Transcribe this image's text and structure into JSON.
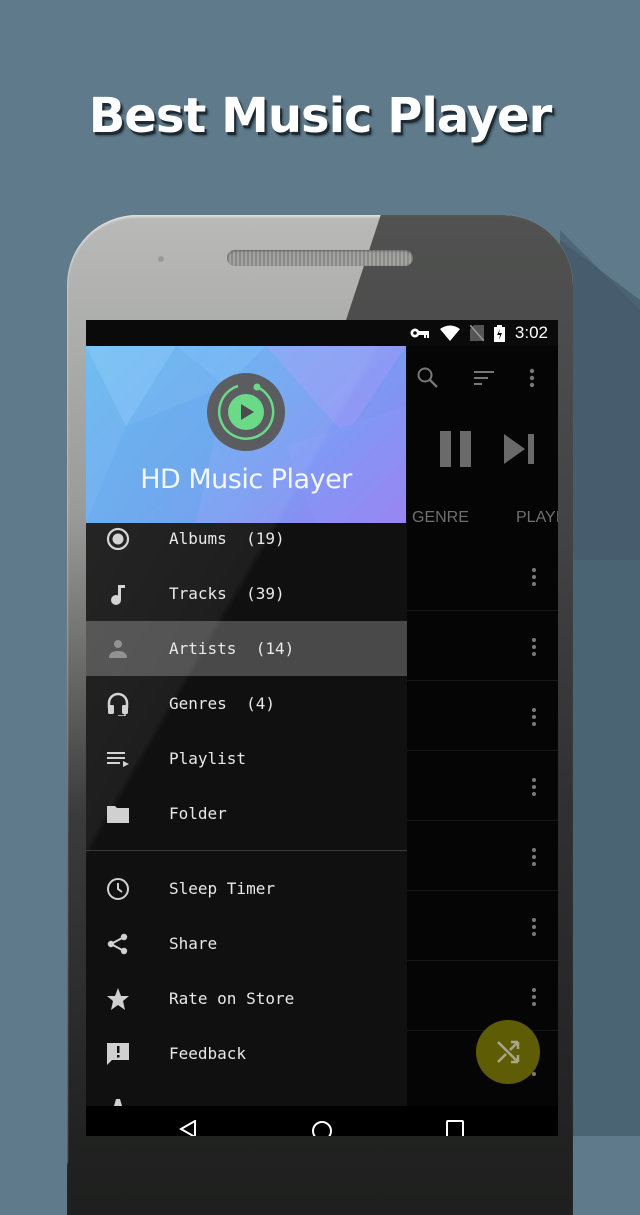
{
  "headline": "Best Music Player",
  "status_bar": {
    "icons": [
      "vpn-key-icon",
      "wifi-icon",
      "no-sim-icon",
      "battery-charging-icon"
    ],
    "time": "3:02"
  },
  "drawer": {
    "app_name": "HD Music Player",
    "primary_items": [
      {
        "icon": "album-icon",
        "label": "Albums  (19)"
      },
      {
        "icon": "music-note-icon",
        "label": "Tracks  (39)"
      },
      {
        "icon": "person-icon",
        "label": "Artists  (14)",
        "active": true
      },
      {
        "icon": "headphones-icon",
        "label": "Genres  (4)"
      },
      {
        "icon": "playlist-icon",
        "label": "Playlist"
      },
      {
        "icon": "folder-icon",
        "label": "Folder"
      }
    ],
    "secondary_items": [
      {
        "icon": "clock-icon",
        "label": "Sleep Timer"
      },
      {
        "icon": "share-icon",
        "label": "Share"
      },
      {
        "icon": "star-icon",
        "label": "Rate on Store"
      },
      {
        "icon": "feedback-icon",
        "label": "Feedback"
      }
    ]
  },
  "main": {
    "toolbar_icons": [
      "search-icon",
      "sort-icon",
      "more-vert-icon"
    ],
    "player_controls": [
      "pause-icon",
      "skip-next-icon"
    ],
    "tabs": [
      "GENRE",
      "PLAYI"
    ],
    "list_rows": 8,
    "fab_icon": "shuffle-icon",
    "fab_color": "#5f5c06"
  },
  "nav_bar": [
    "back-icon",
    "home-icon",
    "recents-icon"
  ],
  "colors": {
    "background": "#5f7a8a",
    "drawer_bg": "#101010",
    "active_item_bg": "#4a4a4a",
    "logo_green": "#5fd67f"
  }
}
